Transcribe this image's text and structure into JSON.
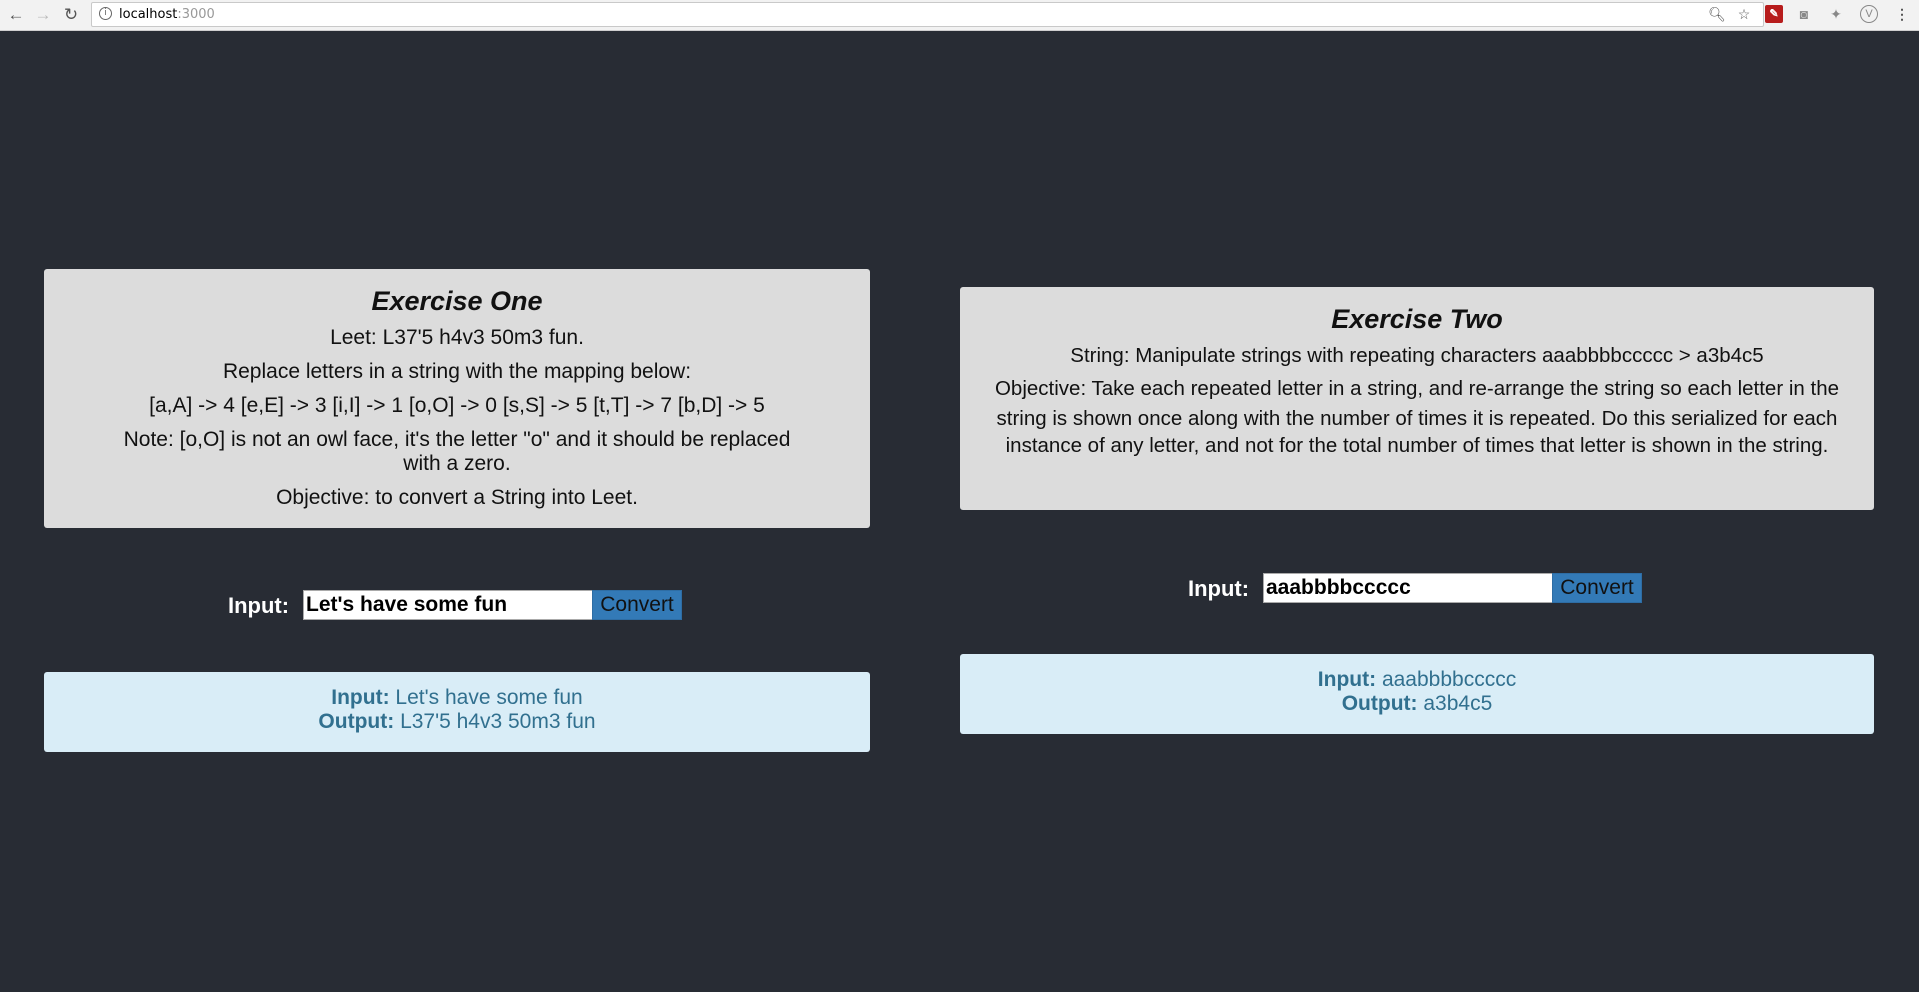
{
  "browser": {
    "url_host": "localhost",
    "url_port": ":3000"
  },
  "exercise_one": {
    "title": "Exercise One",
    "lines": [
      "Leet: L37'5 h4v3 50m3 fun.",
      "Replace letters in a string with the mapping below:",
      "[a,A] -> 4 [e,E] -> 3 [i,I] -> 1 [o,O] -> 0 [s,S] -> 5 [t,T] -> 7 [b,D] -> 5",
      "Note: [o,O] is not an owl face, it's the letter \"o\" and it should be replaced with a zero.",
      "Objective: to convert a String into Leet."
    ],
    "input_label": "Input:",
    "input_value": "Let's have some fun",
    "button_label": "Convert",
    "result": {
      "input_label": "Input:",
      "input_value": "Let's have some fun",
      "output_label": "Output:",
      "output_value": "L37'5 h4v3 50m3 fun"
    }
  },
  "exercise_two": {
    "title": "Exercise Two",
    "lines": [
      "String: Manipulate strings with repeating characters aaabbbbccccc > a3b4c5",
      "Objective: Take each repeated letter in a string, and re-arrange the string so each letter in the",
      "string is shown once along with the number of times it is repeated. Do this serialized for each",
      "instance of any letter, and not for the total number of times that letter is shown in the string."
    ],
    "input_label": "Input:",
    "input_value": "aaabbbbccccc",
    "button_label": "Convert",
    "result": {
      "input_label": "Input:",
      "input_value": "aaabbbbccccc",
      "output_label": "Output:",
      "output_value": "a3b4c5"
    }
  }
}
